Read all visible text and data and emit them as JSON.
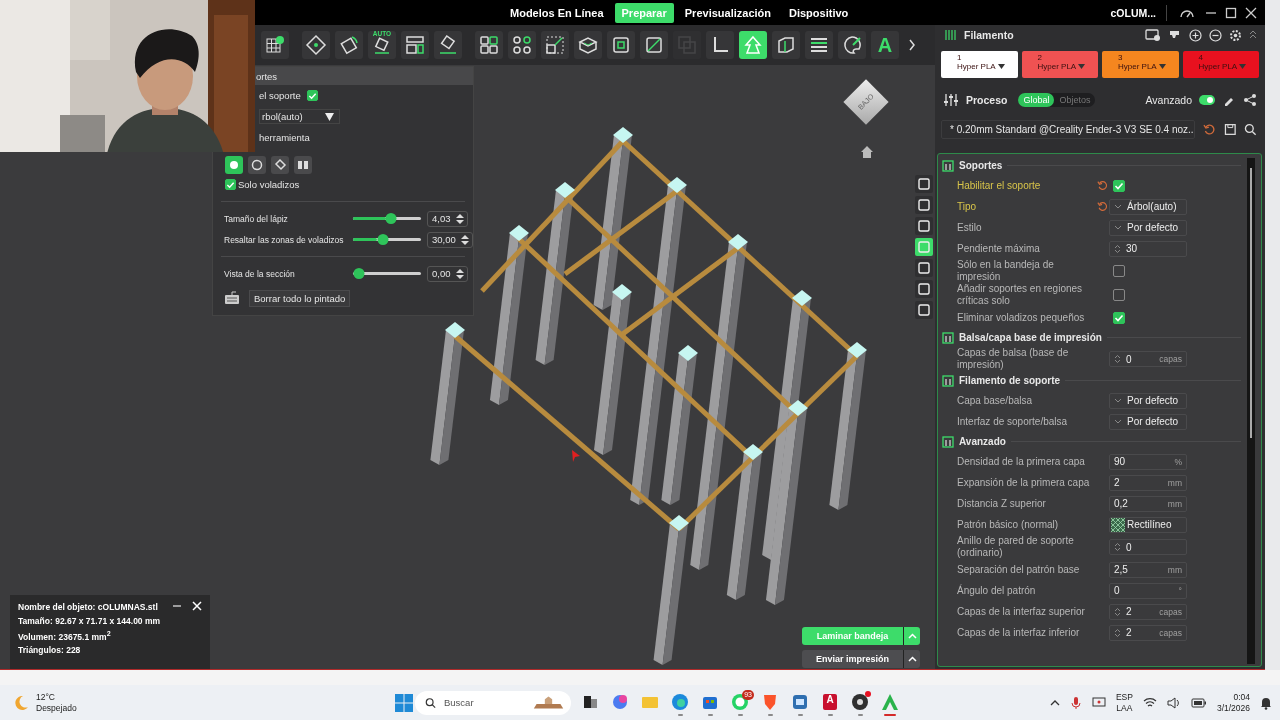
{
  "title_bar": {
    "tabs": [
      {
        "label": "Modelos En Línea",
        "selected": false
      },
      {
        "label": "Preparar",
        "selected": true
      },
      {
        "label": "Previsualización",
        "selected": false
      },
      {
        "label": "Dispositivo",
        "selected": false
      }
    ],
    "document": "cOLUM..."
  },
  "toolbar": {
    "tools": [
      {
        "selected": false,
        "disabled": false
      },
      {
        "selected": false,
        "disabled": false
      },
      {
        "selected": false,
        "disabled": false
      },
      {
        "selected": false,
        "disabled": false,
        "label": "AUTO"
      },
      {
        "selected": false,
        "disabled": false
      },
      {
        "selected": false,
        "disabled": false
      },
      {
        "selected": false,
        "disabled": false
      },
      {
        "selected": false,
        "disabled": false
      },
      {
        "selected": false,
        "disabled": false
      },
      {
        "selected": false,
        "disabled": false
      },
      {
        "selected": false,
        "disabled": false
      },
      {
        "selected": false,
        "disabled": false
      },
      {
        "selected": false,
        "disabled": true
      },
      {
        "selected": false,
        "disabled": false
      },
      {
        "selected": true,
        "disabled": false
      },
      {
        "selected": false,
        "disabled": false
      },
      {
        "selected": false,
        "disabled": false
      },
      {
        "selected": false,
        "disabled": false
      },
      {
        "selected": false,
        "disabled": false,
        "glyph": "A"
      }
    ]
  },
  "support_panel": {
    "title": "ortes",
    "enable_label": "el soporte",
    "enable_checked": true,
    "type_value": "rbol(auto)",
    "tool_label": "herramienta",
    "tools": [
      {
        "selected": true
      },
      {
        "selected": false
      },
      {
        "selected": false
      },
      {
        "selected": false
      }
    ],
    "only_overhangs": {
      "label": "Solo voladizos",
      "checked": true
    },
    "sliders": [
      {
        "label": "Tamaño del lápiz",
        "level": 0.48,
        "value": "4,03"
      },
      {
        "label": "Resaltar las zonas de voladizos",
        "level": 0.36,
        "value": "30,00"
      },
      {
        "label": "Vista de la sección",
        "level": 0.0,
        "value": "0,00"
      }
    ],
    "clear_button": "Borrar todo lo pintado"
  },
  "view_cube": "BAJO",
  "side_tools": [
    {
      "selected": false
    },
    {
      "selected": false
    },
    {
      "selected": false
    },
    {
      "selected": true
    },
    {
      "selected": false
    },
    {
      "selected": false
    },
    {
      "selected": false
    }
  ],
  "object_info": {
    "lines": [
      "Nombre del objeto: cOLUMNAS.stl",
      "Tamaño: 92.67 x 71.71 x 144.00 mm",
      "Volumen: 23675.1 mm$^{2}$",
      "Triángulos: 228"
    ]
  },
  "slice_buttons": [
    "Laminar bandeja",
    "Enviar impresión"
  ],
  "filament": {
    "title": "Filamento",
    "slots": [
      {
        "number": "1",
        "name": "Hyper PLA",
        "color": "#ffffff"
      },
      {
        "number": "2",
        "name": "Hyper PLA",
        "color": "#f05252"
      },
      {
        "number": "3",
        "name": "Hyper PLA",
        "color": "#f5861f"
      },
      {
        "number": "4",
        "name": "Hyper PLA",
        "color": "#e8111f"
      }
    ]
  },
  "process": {
    "title": "Proceso",
    "scopes": [
      {
        "label": "Global",
        "selected": true
      },
      {
        "label": "Objetos",
        "selected": false
      }
    ],
    "advanced_label": "Avanzado",
    "advanced_on": true,
    "preset": "* 0.20mm Standard @Creality Ender-3 V3 SE 0.4 noz..."
  },
  "sections": [
    {
      "title": "Soportes",
      "rows": [
        {
          "label": "Habilitar el soporte",
          "kind": "checkbox",
          "checked": true,
          "modified": true
        },
        {
          "label": "Tipo",
          "kind": "select",
          "value": "Árbol(auto)",
          "modified": true
        },
        {
          "label": "Estilo",
          "kind": "select",
          "value": "Por defecto",
          "modified": false
        },
        {
          "label": "Pendiente máxima",
          "kind": "spin",
          "value": "30",
          "modified": false
        },
        {
          "label": "Sólo en la bandeja de impresión",
          "kind": "checkbox",
          "checked": false,
          "modified": false
        },
        {
          "label": "Añadir soportes en regiones críticas solo",
          "kind": "checkbox",
          "checked": false,
          "modified": false
        },
        {
          "label": "Eliminar voladizos pequeños",
          "kind": "checkbox",
          "checked": true,
          "modified": false
        }
      ]
    },
    {
      "title": "Balsa/capa base de impresión",
      "rows": [
        {
          "label": "Capas de balsa (base de impresión)",
          "kind": "spin",
          "value": "0",
          "unit": "capas",
          "modified": false
        }
      ]
    },
    {
      "title": "Filamento de soporte",
      "rows": [
        {
          "label": "Capa base/balsa",
          "kind": "select",
          "value": "Por defecto",
          "modified": false
        },
        {
          "label": "Interfaz de soporte/balsa",
          "kind": "select",
          "value": "Por defecto",
          "modified": false
        }
      ]
    },
    {
      "title": "Avanzado",
      "rows": [
        {
          "label": "Densidad de la primera capa",
          "kind": "input",
          "value": "90",
          "unit": "%",
          "modified": false
        },
        {
          "label": "Expansión de la primera capa",
          "kind": "input",
          "value": "2",
          "unit": "mm",
          "modified": false
        },
        {
          "label": "Distancia Z superior",
          "kind": "input",
          "value": "0,2",
          "unit": "mm",
          "modified": false
        },
        {
          "label": "Patrón básico (normal)",
          "kind": "pattern",
          "value": "Rectilíneo",
          "modified": false
        },
        {
          "label": "Anillo de pared de soporte (ordinario)",
          "kind": "spin",
          "value": "0",
          "modified": false
        },
        {
          "label": "Separación del patrón base",
          "kind": "input",
          "value": "2,5",
          "unit": "mm",
          "modified": false
        },
        {
          "label": "Ángulo del patrón",
          "kind": "input",
          "value": "0",
          "unit": "°",
          "modified": false
        },
        {
          "label": "Capas de la interfaz superior",
          "kind": "spin",
          "value": "2",
          "unit": "capas",
          "modified": false
        },
        {
          "label": "Capas de la interfaz inferior",
          "kind": "spin",
          "value": "2",
          "unit": "capas",
          "modified": false
        }
      ]
    }
  ],
  "taskbar": {
    "weather": {
      "temp": "12°C",
      "condition": "Despejado"
    },
    "search_placeholder": "Buscar",
    "apps": [
      {
        "running": false,
        "active": false,
        "alert": false
      },
      {
        "running": false,
        "active": false,
        "alert": false
      },
      {
        "running": false,
        "active": false,
        "alert": false
      },
      {
        "running": true,
        "active": false,
        "alert": false
      },
      {
        "running": true,
        "active": false,
        "alert": false
      },
      {
        "running": true,
        "active": false,
        "alert": false,
        "badge": "93"
      },
      {
        "running": true,
        "active": false,
        "alert": false
      },
      {
        "running": true,
        "active": false,
        "alert": false
      },
      {
        "running": true,
        "active": false,
        "alert": false,
        "glyph": "A"
      },
      {
        "running": true,
        "active": false,
        "alert": true
      },
      {
        "running": true,
        "active": true,
        "alert": false
      }
    ],
    "language": "ESP",
    "layout": "LAA",
    "time": "0:04",
    "date": "3/1/2026"
  }
}
